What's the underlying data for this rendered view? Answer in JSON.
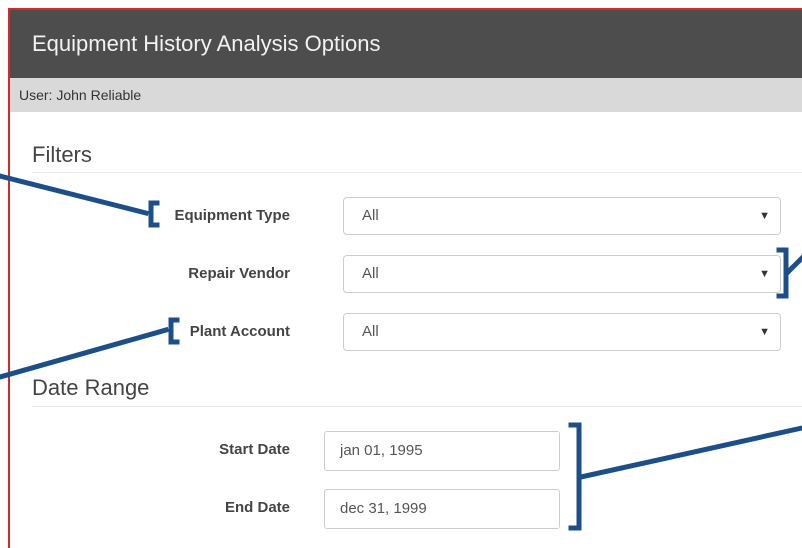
{
  "window": {
    "title": "Equipment History Analysis Options"
  },
  "user": {
    "label": "User: John Reliable"
  },
  "filters": {
    "heading": "Filters",
    "equipment_type": {
      "label": "Equipment Type",
      "value": "All"
    },
    "repair_vendor": {
      "label": "Repair Vendor",
      "value": "All"
    },
    "plant_account": {
      "label": "Plant Account",
      "value": "All"
    },
    "dropdown_arrow": "▼"
  },
  "date_range": {
    "heading": "Date Range",
    "start": {
      "label": "Start Date",
      "value": "jan 01, 1995"
    },
    "end": {
      "label": "End Date",
      "value": "dec 31, 1999"
    }
  },
  "colors": {
    "title_bar": "#4d4d4d",
    "user_bar": "#d9d9d9",
    "frame_border": "#d62828",
    "annotation": "#1c4f8a"
  }
}
